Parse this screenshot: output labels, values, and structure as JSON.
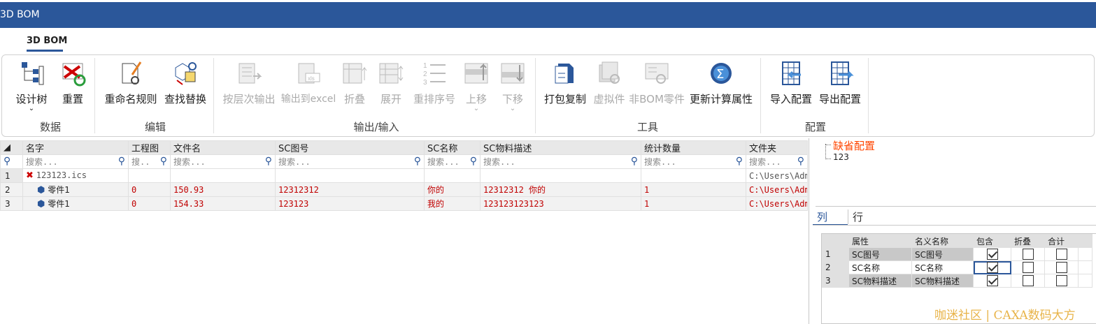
{
  "window": {
    "title": "3D BOM"
  },
  "ribbon": {
    "tab": "3D BOM",
    "groups": [
      {
        "label": "数据",
        "buttons": [
          {
            "label": "设计树",
            "icon": "design-tree-icon",
            "has_dropdown": true,
            "enabled": true
          },
          {
            "label": "重置",
            "icon": "reset-icon",
            "enabled": true
          }
        ]
      },
      {
        "label": "编辑",
        "buttons": [
          {
            "label": "重命名规则",
            "icon": "rename-rule-icon",
            "enabled": true
          },
          {
            "label": "查找替换",
            "icon": "find-replace-icon",
            "enabled": true
          }
        ]
      },
      {
        "label": "输出/输入",
        "buttons": [
          {
            "label": "按层次输出",
            "icon": "output-hierarchy-icon",
            "enabled": false
          },
          {
            "label": "输出到excel",
            "icon": "export-excel-icon",
            "enabled": false
          },
          {
            "label": "折叠",
            "icon": "collapse-icon",
            "enabled": false
          },
          {
            "label": "展开",
            "icon": "expand-icon",
            "enabled": false
          },
          {
            "label": "重排序号",
            "icon": "renumber-icon",
            "enabled": false
          },
          {
            "label": "上移",
            "icon": "move-up-icon",
            "has_dropdown": true,
            "enabled": false
          },
          {
            "label": "下移",
            "icon": "move-down-icon",
            "has_dropdown": true,
            "enabled": false
          }
        ]
      },
      {
        "label": "工具",
        "buttons": [
          {
            "label": "打包复制",
            "icon": "pack-copy-icon",
            "enabled": true
          },
          {
            "label": "虚拟件",
            "icon": "virtual-part-icon",
            "enabled": false
          },
          {
            "label": "非BOM零件",
            "icon": "non-bom-part-icon",
            "enabled": false
          },
          {
            "label": "更新计算属性",
            "icon": "sigma-icon",
            "enabled": true
          }
        ]
      },
      {
        "label": "配置",
        "buttons": [
          {
            "label": "导入配置",
            "icon": "import-config-icon",
            "enabled": true
          },
          {
            "label": "导出配置",
            "icon": "export-config-icon",
            "enabled": true
          }
        ]
      }
    ]
  },
  "grid": {
    "columns": [
      "名字",
      "工程图",
      "文件名",
      "SC图号",
      "SC名称",
      "SC物料描述",
      "统计数量",
      "文件夹"
    ],
    "search_placeholders": [
      "搜索...",
      "搜..",
      "搜索...",
      "搜索...",
      "搜索...",
      "搜索...",
      "搜索...",
      "搜索..."
    ],
    "rows": [
      {
        "num": "1",
        "name": "123123.ics",
        "drawing": "",
        "filename": "",
        "sc_no": "",
        "sc_name": "",
        "sc_desc": "",
        "qty": "",
        "folder": "C:\\Users\\Adm"
      },
      {
        "num": "2",
        "name": "零件1",
        "drawing": "0",
        "filename": "150.93",
        "sc_no": "12312312",
        "sc_name": "你的",
        "sc_desc": "12312312 你的",
        "qty": "1",
        "folder": "C:\\Users\\Adm"
      },
      {
        "num": "3",
        "name": "零件1",
        "drawing": "0",
        "filename": "154.33",
        "sc_no": "123123",
        "sc_name": "我的",
        "sc_desc": "123123123123",
        "qty": "1",
        "folder": "C:\\Users\\Adm"
      }
    ]
  },
  "config_tree": {
    "items": [
      "缺省配置",
      "123"
    ]
  },
  "config_tabs": [
    "列",
    "行"
  ],
  "config_table": {
    "headers": [
      "属性",
      "名义名称",
      "包含",
      "折叠",
      "合计"
    ],
    "rows": [
      {
        "num": "1",
        "attr": "SC图号",
        "name": "SC图号",
        "include": true,
        "fold": false,
        "sum": false
      },
      {
        "num": "2",
        "attr": "SC名称",
        "name": "SC名称",
        "include": true,
        "fold": false,
        "sum": false
      },
      {
        "num": "3",
        "attr": "SC物料描述",
        "name": "SC物料描述",
        "include": true,
        "fold": false,
        "sum": false
      }
    ]
  },
  "watermark": "咖迷社区 | CAXA数码大方",
  "colors": {
    "title_bar": "#2b579a",
    "error_text": "#c00000",
    "default_config": "#ff4500"
  }
}
